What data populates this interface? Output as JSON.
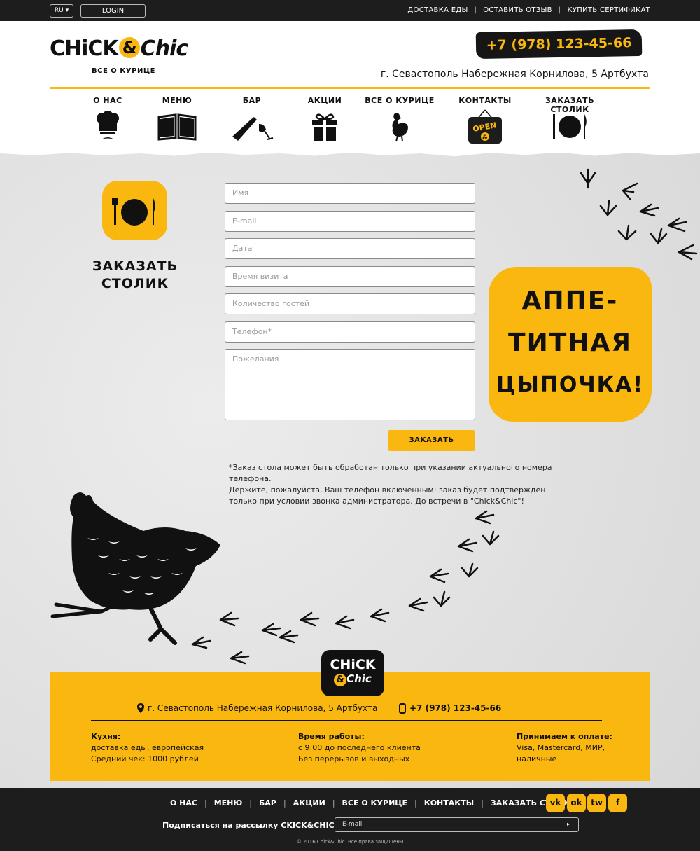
{
  "topbar": {
    "lang": "RU ▾",
    "login": "LOGIN",
    "links": [
      "ДОСТАВКА ЕДЫ",
      "ОСТАВИТЬ ОТЗЫВ",
      "КУПИТЬ СЕРТИФИКАТ"
    ]
  },
  "header": {
    "logo_part1": "CHiCK",
    "logo_amp": "&",
    "logo_part2": "Chic",
    "logo_sub": "ВСЕ О КУРИЦЕ",
    "phone": "+7 (978) 123-45-66",
    "address": "г. Севастополь Набережная Корнилова, 5 Артбухта"
  },
  "mainnav": [
    {
      "label": "О НАС",
      "icon": "chef-hat-icon"
    },
    {
      "label": "МЕНЮ",
      "icon": "book-icon"
    },
    {
      "label": "БАР",
      "icon": "wine-icon"
    },
    {
      "label": "АКЦИИ",
      "icon": "gift-icon"
    },
    {
      "label": "ВСЕ О КУРИЦЕ",
      "icon": "chicken-icon"
    },
    {
      "label": "КОНТАКТЫ",
      "icon": "open-sign-icon"
    },
    {
      "label": "ЗАКАЗАТЬ СТОЛИК",
      "icon": "plate-icon"
    }
  ],
  "open_sign": {
    "line1": "OPEN",
    "amp": "&"
  },
  "reserve": {
    "title_line1": "ЗАКАЗАТЬ",
    "title_line2": "СТОЛИК"
  },
  "form": {
    "name_placeholder": "Имя",
    "email_placeholder": "E-mail",
    "date_placeholder": "Дата",
    "time_placeholder": "Время визита",
    "guests_placeholder": "Количество гостей",
    "phone_placeholder": "Телефон*",
    "wishes_placeholder": "Пожелания",
    "submit": "ЗАКАЗАТЬ",
    "note_line1": "*Заказ стола может быть обработан только при указании актуального номера телефона.",
    "note_line2": "Держите, пожалуйста, Ваш телефон включенным: заказ будет подтвержден",
    "note_line3": "только при условии звонка администратора. До встречи в \"Chick&Chic\"!"
  },
  "promo": {
    "line1": "АППЕ-",
    "line2": "ТИТНАЯ",
    "line3": "ЦЫПОЧКА!"
  },
  "footer": {
    "logo_line1": "CHiCK",
    "logo_amp": "&",
    "logo_line2": "Chic",
    "address": "г. Севастополь Набережная Корнилова, 5 Артбухта",
    "phone": "+7 (978) 123-45-66",
    "col1_title": "Кухня:",
    "col1_line1": "доставка еды, европейская",
    "col1_line2": "Средний чек: 1000 рублей",
    "col2_title": "Время работы:",
    "col2_line1": "с 9:00 до последнего клиента",
    "col2_line2": "Без перерывов и выходных",
    "col3_title": "Принимаем к оплате:",
    "col3_line1": "Visa, Mastercard, МИР,",
    "col3_line2": "наличные",
    "nav": [
      "О НАС",
      "МЕНЮ",
      "БАР",
      "АКЦИИ",
      "ВСЕ О КУРИЦЕ",
      "КОНТАКТЫ",
      "ЗАКАЗАТЬ СТОЛИК"
    ],
    "social": {
      "vk": "vk",
      "ok": "ok",
      "tw": "tw",
      "fb": "f"
    },
    "subscribe_label": "Подписаться на рассылку CKICK&CHIC:",
    "subscribe_placeholder": "E-mail",
    "subscribe_go": "▸",
    "copyright": "© 2016 Chick&Chic. Все права защищены"
  },
  "colors": {
    "accent": "#f9b70f",
    "dark": "#1d1d1d",
    "bg": "#e3e3e3"
  }
}
